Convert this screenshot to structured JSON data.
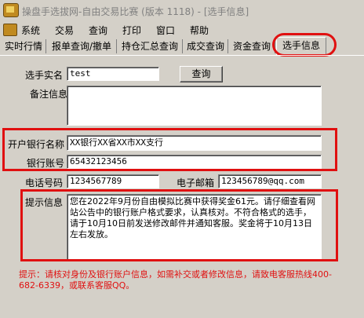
{
  "window": {
    "title": "操盘手选拔网-自由交易比赛 (版本 1118) - [选手信息]"
  },
  "menu": [
    "系统",
    "交易",
    "查询",
    "打印",
    "窗口",
    "帮助"
  ],
  "tabs": [
    "实时行情",
    "报单查询/撤单",
    "持仓汇总查询",
    "成交查询",
    "资金查询",
    "选手信息"
  ],
  "form": {
    "name_label": "选手实名",
    "name_value": "test",
    "query_button": "查询",
    "remark_label": "备注信息1",
    "remark_value": "",
    "bank_label": "开户银行名称",
    "bank_value": "XX银行XX省XX市XX支行",
    "account_label": "银行账号",
    "account_value": "65432123456",
    "phone_label": "电话号码",
    "phone_value": "1234567789",
    "email_label": "电子邮箱",
    "email_value": "123456789@qq.com",
    "notice_label": "提示信息",
    "notice_value": "您在2022年9月份自由模拟比赛中获得奖金61元。请仔细查看网站公告中的银行账户格式要求，认真核对。不符合格式的选手，请于10月10日前发送修改邮件并通知客服。奖金将于10月13日左右发放。"
  },
  "hint": "提示：请核对身份及银行账户信息，如需补交或者修改信息，请致电客服热线400-682-6339，或联系客服QQ。",
  "colors": {
    "highlight": "#e01010",
    "window_bg": "#d4d0c8"
  }
}
